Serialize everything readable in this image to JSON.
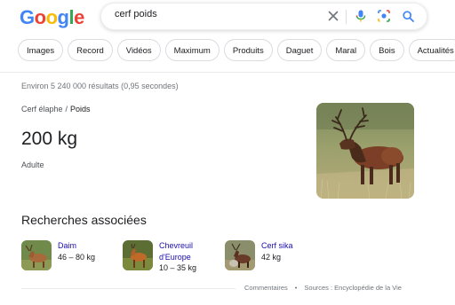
{
  "logo": {
    "letters": [
      "G",
      "o",
      "o",
      "g",
      "l",
      "e"
    ],
    "colors": [
      "#4285f4",
      "#ea4335",
      "#fbbc05",
      "#4285f4",
      "#34a853",
      "#ea4335"
    ]
  },
  "search": {
    "query": "cerf poids"
  },
  "chips": [
    "Images",
    "Record",
    "Vidéos",
    "Maximum",
    "Produits",
    "Daguet",
    "Maral",
    "Bois",
    "Actualités"
  ],
  "results_stats": "Environ 5 240 000 résultats (0,95 secondes)",
  "breadcrumb": {
    "parent": "Cerf élaphe",
    "separator": "/",
    "current": "Poids"
  },
  "answer": {
    "value": "200 kg",
    "subtitle": "Adulte"
  },
  "related": {
    "title": "Recherches associées",
    "items": [
      {
        "name": "Daim",
        "value": "46 – 80 kg"
      },
      {
        "name": "Chevreuil d'Europe",
        "value": "10 – 35 kg"
      },
      {
        "name": "Cerf sika",
        "value": "42 kg"
      }
    ]
  },
  "footer": {
    "feedback": "Commentaires",
    "dot": "•",
    "sources": "Sources : Encyclopédie de la Vie"
  },
  "colors": {
    "link": "#1a0dab",
    "mic_blue": "#4285f4",
    "search_blue": "#4285f4"
  }
}
